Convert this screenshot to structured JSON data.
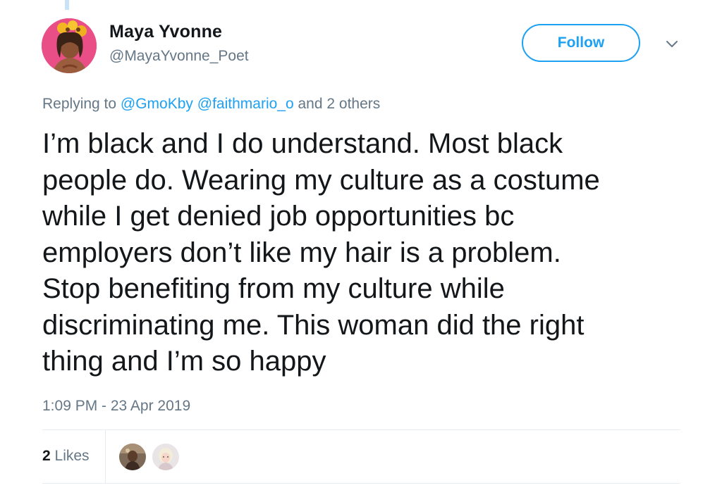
{
  "tweet": {
    "author": {
      "display_name": "Maya Yvonne",
      "handle": "@MayaYvonne_Poet",
      "avatar_icon": "user-avatar-photo"
    },
    "follow_label": "Follow",
    "menu_icon": "chevron-down-icon",
    "replying": {
      "prefix": "Replying to",
      "mentions": [
        "@GmoKby",
        "@faithmario_o"
      ],
      "suffix": "and 2 others"
    },
    "text_lines": [
      "I’m black and I do understand. Most black",
      "people do. Wearing my culture as a costume",
      "while I get denied job opportunities bc",
      "employers don’t like my hair is a problem.",
      "Stop benefiting from my culture while",
      "discriminating me. This woman did the right",
      "thing and I’m so happy"
    ],
    "timestamp": "1:09 PM - 23 Apr 2019",
    "likes": {
      "count": "2",
      "label": "Likes"
    }
  },
  "colors": {
    "accent": "#1da1f2",
    "secondary_text": "#657786",
    "primary_text": "#14171a",
    "divider": "#e6ecf0"
  }
}
